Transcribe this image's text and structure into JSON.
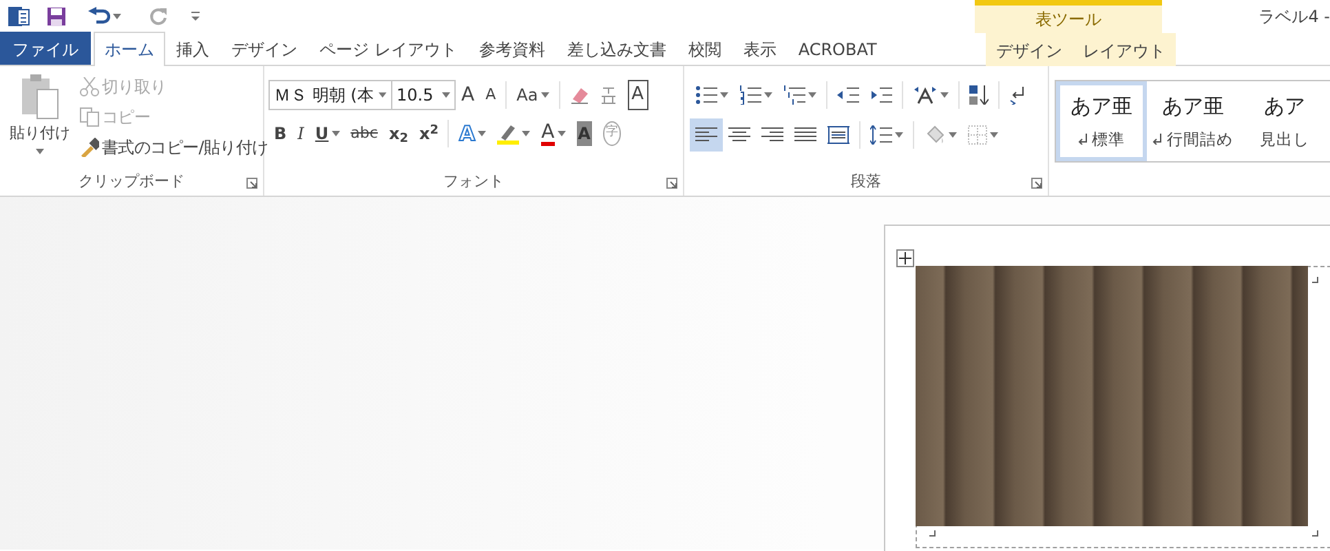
{
  "quick_access": {
    "undo": {
      "disabled": false
    },
    "redo": {
      "disabled": true
    }
  },
  "contextual_group": {
    "label": "表ツール"
  },
  "window": {
    "title": "ラベル4 -"
  },
  "tabs": [
    {
      "label": "ファイル",
      "kind": "file",
      "selected": false
    },
    {
      "label": "ホーム",
      "kind": "normal",
      "selected": true
    },
    {
      "label": "挿入",
      "kind": "normal",
      "selected": false
    },
    {
      "label": "デザイン",
      "kind": "normal",
      "selected": false
    },
    {
      "label": "ページ レイアウト",
      "kind": "normal",
      "selected": false
    },
    {
      "label": "参考資料",
      "kind": "normal",
      "selected": false
    },
    {
      "label": "差し込み文書",
      "kind": "normal",
      "selected": false
    },
    {
      "label": "校閲",
      "kind": "normal",
      "selected": false
    },
    {
      "label": "表示",
      "kind": "normal",
      "selected": false
    },
    {
      "label": "ACROBAT",
      "kind": "normal",
      "selected": false
    },
    {
      "label": "デザイン",
      "kind": "contextual",
      "selected": false
    },
    {
      "label": "レイアウト",
      "kind": "contextual",
      "selected": false
    }
  ],
  "clipboard": {
    "label": "クリップボード",
    "paste": "貼り付け",
    "commands": [
      {
        "label": "切り取り",
        "kind": "cut",
        "disabled": true
      },
      {
        "label": "コピー",
        "kind": "copy",
        "disabled": true
      },
      {
        "label": "書式のコピー/貼り付け",
        "kind": "painter",
        "disabled": false
      }
    ]
  },
  "font": {
    "label": "フォント",
    "font_name": "ＭＳ 明朝 (本",
    "font_size": "10.5",
    "row_1": [
      {
        "kind": "grow",
        "label": "A"
      },
      {
        "kind": "shrink",
        "label": "A"
      },
      {
        "kind": "case",
        "label": "Aa"
      },
      {
        "kind": "clear"
      },
      {
        "kind": "phonetic"
      },
      {
        "kind": "border",
        "label": "A"
      }
    ],
    "row_2": [
      {
        "kind": "bold",
        "label": "B"
      },
      {
        "kind": "italic",
        "label": "I"
      },
      {
        "kind": "underline",
        "label": "U"
      },
      {
        "kind": "strike",
        "label": "abc"
      },
      {
        "kind": "sub",
        "label": "x$_{2}$"
      },
      {
        "kind": "sup",
        "label": "x$^{2}$"
      },
      {
        "kind": "effects",
        "label": "A"
      },
      {
        "kind": "highlight"
      },
      {
        "kind": "color",
        "label": "A"
      },
      {
        "kind": "shading",
        "label": "A"
      },
      {
        "kind": "enclose",
        "label": "字"
      }
    ]
  },
  "paragraph": {
    "label": "段落",
    "alignment": [
      {
        "kind": "left",
        "selected": true
      },
      {
        "kind": "center",
        "selected": false
      },
      {
        "kind": "right",
        "selected": false
      },
      {
        "kind": "justify",
        "selected": false
      },
      {
        "kind": "distributed",
        "selected": false
      }
    ]
  },
  "styles": [
    {
      "preview": "あア亜",
      "name": "標準",
      "mark": true,
      "selected": true
    },
    {
      "preview": "あア亜",
      "name": "行間詰め",
      "mark": true,
      "selected": false
    },
    {
      "preview": "あア",
      "name": "見出し",
      "mark": false,
      "selected": false
    }
  ]
}
